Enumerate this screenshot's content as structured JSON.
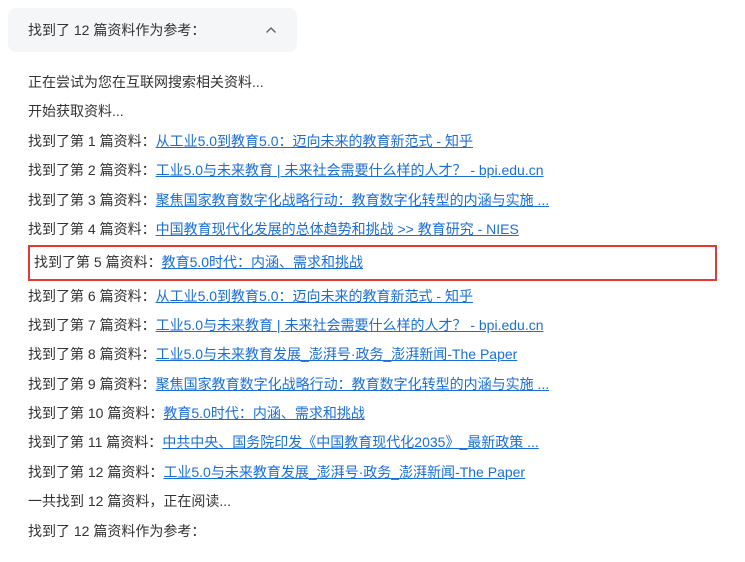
{
  "summary": {
    "text": "找到了 12 篇资料作为参考："
  },
  "intro": {
    "line1": "正在尝试为您在互联网搜索相关资料...",
    "line2": "开始获取资料..."
  },
  "results": [
    {
      "prefix": "找到了第 1 篇资料：",
      "title": "从工业5.0到教育5.0：迈向未来的教育新范式 - 知乎"
    },
    {
      "prefix": "找到了第 2 篇资料：",
      "title": "工业5.0与未来教育 | 未来社会需要什么样的人才？ - bpi.edu.cn"
    },
    {
      "prefix": "找到了第 3 篇资料：",
      "title": "聚焦国家教育数字化战略行动：教育数字化转型的内涵与实施 ..."
    },
    {
      "prefix": "找到了第 4 篇资料：",
      "title": "中国教育现代化发展的总体趋势和挑战 >> 教育研究 - NIES"
    },
    {
      "prefix": "找到了第 5 篇资料：",
      "title": "教育5.0时代：内涵、需求和挑战"
    },
    {
      "prefix": "找到了第 6 篇资料：",
      "title": "从工业5.0到教育5.0：迈向未来的教育新范式 - 知乎"
    },
    {
      "prefix": "找到了第 7 篇资料：",
      "title": "工业5.0与未来教育 | 未来社会需要什么样的人才？ - bpi.edu.cn"
    },
    {
      "prefix": "找到了第 8 篇资料：",
      "title": "工业5.0与未来教育发展_澎湃号·政务_澎湃新闻-The Paper"
    },
    {
      "prefix": "找到了第 9 篇资料：",
      "title": "聚焦国家教育数字化战略行动：教育数字化转型的内涵与实施 ..."
    },
    {
      "prefix": "找到了第 10 篇资料：",
      "title": "教育5.0时代：内涵、需求和挑战"
    },
    {
      "prefix": "找到了第 11 篇资料：",
      "title": "中共中央、国务院印发《中国教育现代化2035》_最新政策 ..."
    },
    {
      "prefix": "找到了第 12 篇资料：",
      "title": "工业5.0与未来教育发展_澎湃号·政务_澎湃新闻-The Paper"
    }
  ],
  "footer": {
    "line1": "一共找到 12 篇资料，正在阅读...",
    "line2": "找到了 12 篇资料作为参考："
  },
  "highlighted_index": 4
}
